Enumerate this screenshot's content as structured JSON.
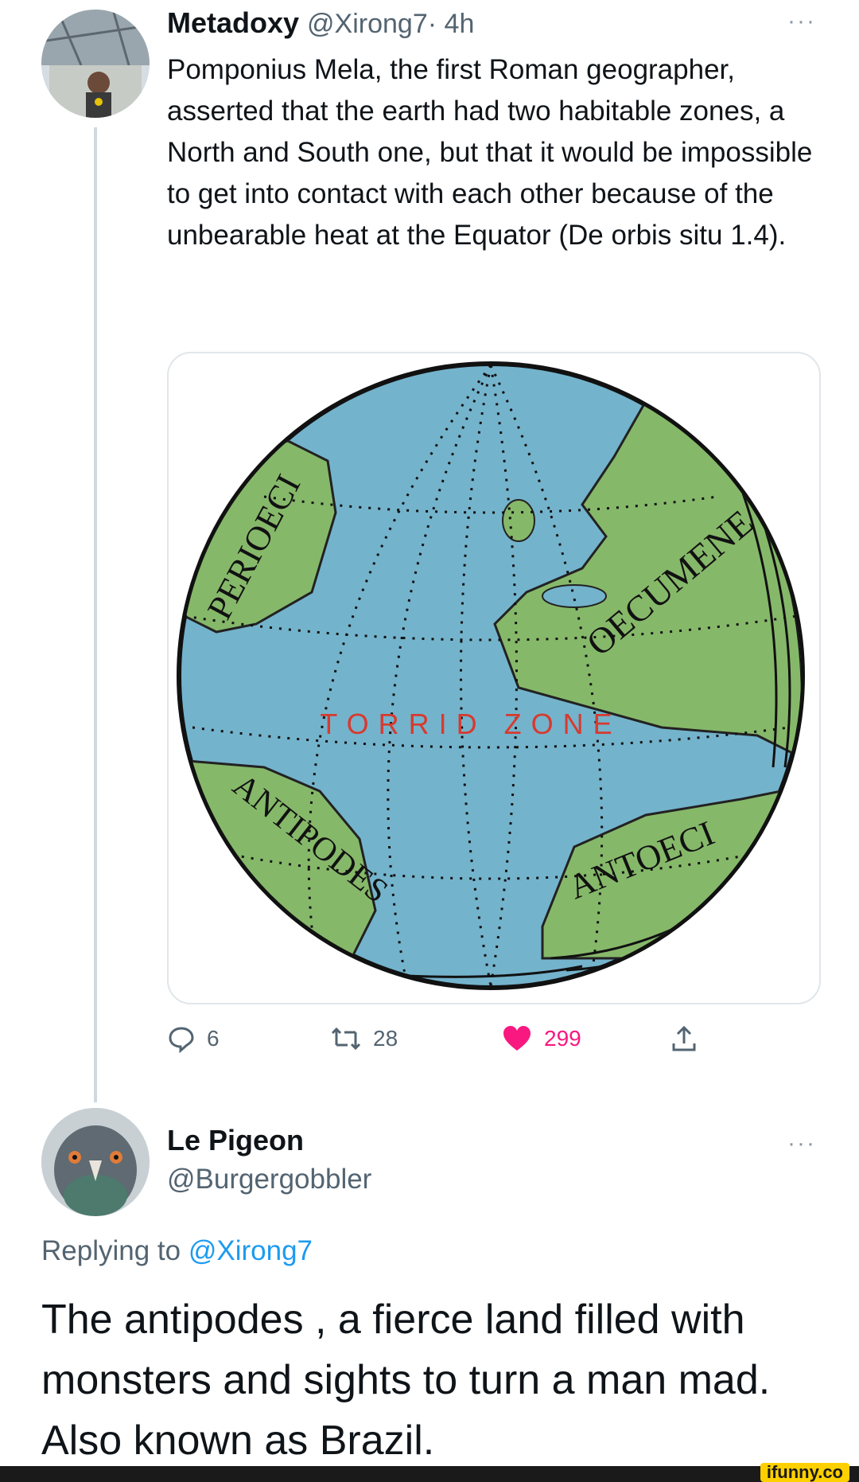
{
  "tweet1": {
    "display_name": "Metadoxy",
    "handle": "@Xirong7",
    "time": " · 4h",
    "more": "···",
    "text": "Pomponius Mela, the first Roman geographer, asserted that the earth had two habitable zones, a North and South one, but that it would be impossible to get into contact with each other because of the unbearable heat at the Equator (De orbis situ 1.4).",
    "media": {
      "labels": {
        "perioeci": "PERIOECI",
        "oecumene": "OECUMENE",
        "torrid_zone": "TORRID ZONE",
        "antipodes": "ANTIPODES",
        "antoeci": "ANTOECI"
      }
    },
    "actions": {
      "replies": "6",
      "retweets": "28",
      "likes": "299"
    },
    "colors": {
      "like": "#f91880",
      "muted": "#536471"
    }
  },
  "tweet2": {
    "display_name": "Le Pigeon",
    "handle": "@Burgergobbler",
    "more": "···",
    "replying_prefix": "Replying to ",
    "replying_to": "@Xirong7",
    "text": "The antipodes , a fierce land filled with monsters and sights to turn a man mad. Also known as Brazil.",
    "colors": {
      "link": "#1d9bf0"
    }
  },
  "watermark": "ifunny.co"
}
